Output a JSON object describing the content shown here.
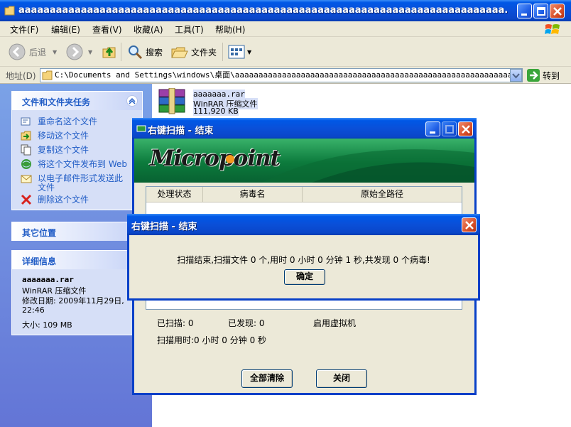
{
  "explorer": {
    "title": "aaaaaaaaaaaaaaaaaaaaaaaaaaaaaaaaaaaaaaaaaaaaaaaaaaaaaaaaaaaaaaaaaaaaaaaaaaaaaa...",
    "menu": [
      "文件(F)",
      "编辑(E)",
      "查看(V)",
      "收藏(A)",
      "工具(T)",
      "帮助(H)"
    ],
    "toolbar": {
      "back": "后退",
      "search": "搜索",
      "folders": "文件夹"
    },
    "address": {
      "label": "地址(D)",
      "value": "C:\\Documents and Settings\\windows\\桌面\\aaaaaaaaaaaaaaaaaaaaaaaaaaaaaaaaaaaaaaaaaaaaaaaaaaaaaaaaaaaaaa",
      "go": "转到"
    },
    "tasks": {
      "title": "文件和文件夹任务",
      "items": [
        "重命名这个文件",
        "移动这个文件",
        "复制这个文件",
        "将这个文件发布到 Web",
        "以电子邮件形式发送此文件",
        "删除这个文件"
      ]
    },
    "other_places": {
      "title": "其它位置"
    },
    "details": {
      "title": "详细信息",
      "name": "aaaaaaa.rar",
      "type": "WinRAR 压缩文件",
      "modified": "修改日期: 2009年11月29日, 22:46",
      "size": "大小: 109 MB"
    },
    "file": {
      "name": "aaaaaaa.rar",
      "type": "WinRAR 压缩文件",
      "size": "111,920 KB"
    }
  },
  "scanner": {
    "title": "右键扫描 - 结束",
    "brand": "Micropoint",
    "columns": [
      "处理状态",
      "病毒名",
      "原始全路径"
    ],
    "stats": {
      "scanned": "已扫描: 0",
      "found": "已发现: 0",
      "vm": "启用虚拟机",
      "time": "扫描用时:0 小时 0 分钟 0 秒"
    },
    "buttons": {
      "clear": "全部清除",
      "close": "关闭"
    }
  },
  "dialog": {
    "title": "右键扫描 - 结束",
    "message": "扫描结束,扫描文件 0 个,用时 0 小时 0 分钟 1 秒,共发现 0 个病毒!",
    "ok": "确定"
  }
}
